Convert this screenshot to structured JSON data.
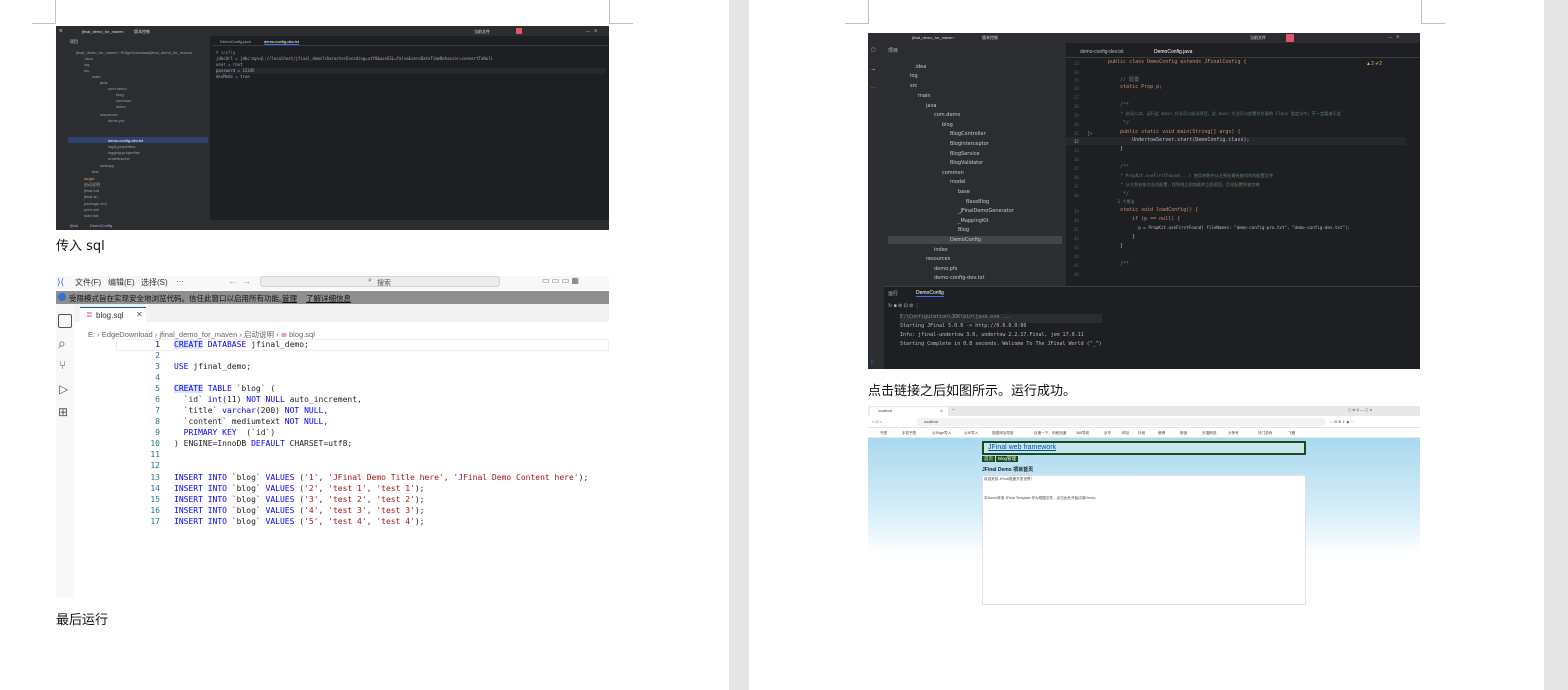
{
  "captions": {
    "sql_caption": "传入 sql",
    "last_caption": "最后运行",
    "success_caption": "点击链接之后如图所示。运行成功。"
  },
  "screenshot1": {
    "project_title": "jfinal_demo_for_maven",
    "branch": "版本控制",
    "run_config": "当前文件",
    "project_label": "项目",
    "tabs": [
      "DemoConfig.java",
      "demo-config-dev.txt"
    ],
    "tree": [
      "jfinal_demo_for_maven  ~/EdgeDownload/jfinal_demo_for_maven",
      ".idea",
      "log",
      "src",
      "main",
      "java",
      "com.demo",
      "blog",
      "common",
      "index",
      "resources",
      "demo.pfx",
      "demo-config-dev.txt",
      "log4j.properties",
      "logging.properties",
      "undertow.txt",
      "webapp",
      "test",
      "target",
      "启动说明",
      "jfinal.bat",
      "jfinal.sh",
      "package.xml",
      "pom.xml",
      "start.bat",
      "外部库"
    ],
    "code": [
      "# config",
      "jdbcUrl = jdbc:mysql://localhost/jfinal_demo?characterEncoding=utf8&useSSL=false&zeroDateTimeBehavior=convertToNull",
      "user = root",
      "password = 12345",
      "devMode = true"
    ],
    "status": [
      "jfinal",
      "DemoConfig"
    ]
  },
  "vscode": {
    "menus": [
      "文件(F)",
      "编辑(E)",
      "选择(S)",
      "···"
    ],
    "search_placeholder": "搜索",
    "banner_text": "受限模式旨在实现安全地浏览代码。信任此窗口以启用所有功能。",
    "banner_manage": "管理",
    "banner_learn": "了解详细信息",
    "tab": "blog.sql",
    "breadcrumb": [
      "E:",
      "EdgeDownload",
      "jfinal_demo_for_maven",
      "启动说明",
      "blog.sql"
    ],
    "lines": [
      {
        "n": "1",
        "t": "CREATE DATABASE jfinal_demo;"
      },
      {
        "n": "2",
        "t": ""
      },
      {
        "n": "3",
        "t": "USE jfinal_demo;"
      },
      {
        "n": "4",
        "t": ""
      },
      {
        "n": "5",
        "t": "CREATE TABLE `blog` ("
      },
      {
        "n": "6",
        "t": "  `id` int(11) NOT NULL auto_increment,"
      },
      {
        "n": "7",
        "t": "  `title` varchar(200) NOT NULL,"
      },
      {
        "n": "8",
        "t": "  `content` mediumtext NOT NULL,"
      },
      {
        "n": "9",
        "t": "  PRIMARY KEY  (`id`)"
      },
      {
        "n": "10",
        "t": ") ENGINE=InnoDB DEFAULT CHARSET=utf8;"
      },
      {
        "n": "11",
        "t": ""
      },
      {
        "n": "12",
        "t": ""
      },
      {
        "n": "13",
        "t": "INSERT INTO `blog` VALUES ('1', 'JFinal Demo Title here', 'JFinal Demo Content here');"
      },
      {
        "n": "14",
        "t": "INSERT INTO `blog` VALUES ('2', 'test 1', 'test 1');"
      },
      {
        "n": "15",
        "t": "INSERT INTO `blog` VALUES ('3', 'test 2', 'test 2');"
      },
      {
        "n": "16",
        "t": "INSERT INTO `blog` VALUES ('4', 'test 3', 'test 3');"
      },
      {
        "n": "17",
        "t": "INSERT INTO `blog` VALUES ('5', 'test 4', 'test 4');"
      }
    ]
  },
  "screenshot2": {
    "project_title": "jfinal_demo_for_maven",
    "branch": "版本控制",
    "run_config": "当前文件",
    "project_label": "项目",
    "tabs": [
      "demo-config-dev.txt",
      "DemoConfig.java"
    ],
    "tree": [
      ".idea",
      "log",
      "src",
      "main",
      "java",
      "com.demo",
      "blog",
      "BlogController",
      "BlogInterceptor",
      "BlogService",
      "BlogValidator",
      "common",
      "model",
      "base",
      "BaseBlog",
      "_JFinalDemoGenerator",
      "_MappingKit",
      "Blog",
      "DemoConfig",
      "index",
      "resources",
      "demo.pfx",
      "demo-config-dev.txt"
    ],
    "line_numbers": [
      "23",
      "24",
      "25",
      "26",
      "27",
      "28",
      "29",
      "30",
      "31",
      "32",
      "33",
      "34",
      "35",
      "36",
      "37",
      "38",
      "39",
      "40",
      "41",
      "42",
      "43",
      "44",
      "45",
      "46"
    ],
    "code": [
      "public class DemoConfig extends JFinalConfig {",
      "",
      "    // 配置",
      "    static Prop p;",
      "",
      "    /**",
      "     * 启动入口，运行此 main 方法可以启动项目，此 main 方法可以放置在任意的 Class 类定义中，不一定要放于此",
      "     */",
      "    public static void main(String[] args) {",
      "        UndertowServer.start(DemoConfig.class);",
      "    }",
      "",
      "    /**",
      "     * PropKit.useFirstFound(...) 使用参数中从左到右最先被找到的配置文件",
      "     * 从左到右依次去找配置，找到则立即加载并立即返回，后续配置将被忽略",
      "     */",
      "    1 个用法",
      "    static void loadConfig() {",
      "        if (p == null) {",
      "            p = PropKit.useFirstFound( fileNames: \"demo-config-pro.txt\", \"demo-config-dev.txt\");",
      "        }",
      "    }",
      "",
      "    /**"
    ],
    "run_label": "运行",
    "run_tab": "DemoConfig",
    "console": [
      "E:\\Configuration\\JDK\\bin\\java.exe ...",
      "Starting JFinal 5.0.0 -> http://0.0.0.0:80",
      "Info: jfinal-undertow 3.0, undertow 2.2.17.Final, jvm 17.0.11",
      "Starting Complete in 0.8 seconds. Welcome To The JFinal World (^_^)"
    ],
    "warnings": "▲3 ✔2"
  },
  "browser": {
    "tab_title": "localhost",
    "address": "localhost",
    "bookmarks": [
      "书签",
      "手机书签",
      "从Edge导入",
      "从IE导入",
      "搜狐网址导航",
      "百度一下，你就知道",
      "360导航",
      "京东",
      "网址",
      "抖音",
      "微博",
      "新浪",
      "天猫精选",
      "头条号",
      "热门游戏",
      "飞猪"
    ],
    "header_link": "JFinal web framework",
    "nav": [
      "首页",
      "Blog管理"
    ],
    "page_title": "JFinal Demo 项目首页",
    "body_lines": [
      "欢迎来到 JFinal极速开发世界！",
      "本Demo采用 JFinal Template 作为视图文件，点击此处开始试用Demo。"
    ],
    "link_text": "此处"
  },
  "colors": {
    "ide_bg": "#1e1f22",
    "ide_selection": "#2e436e",
    "vscode_banner": "#8f8f8f",
    "sql_keyword": "#0000ff",
    "sql_string": "#a31515",
    "browser_link": "#0050a0"
  }
}
